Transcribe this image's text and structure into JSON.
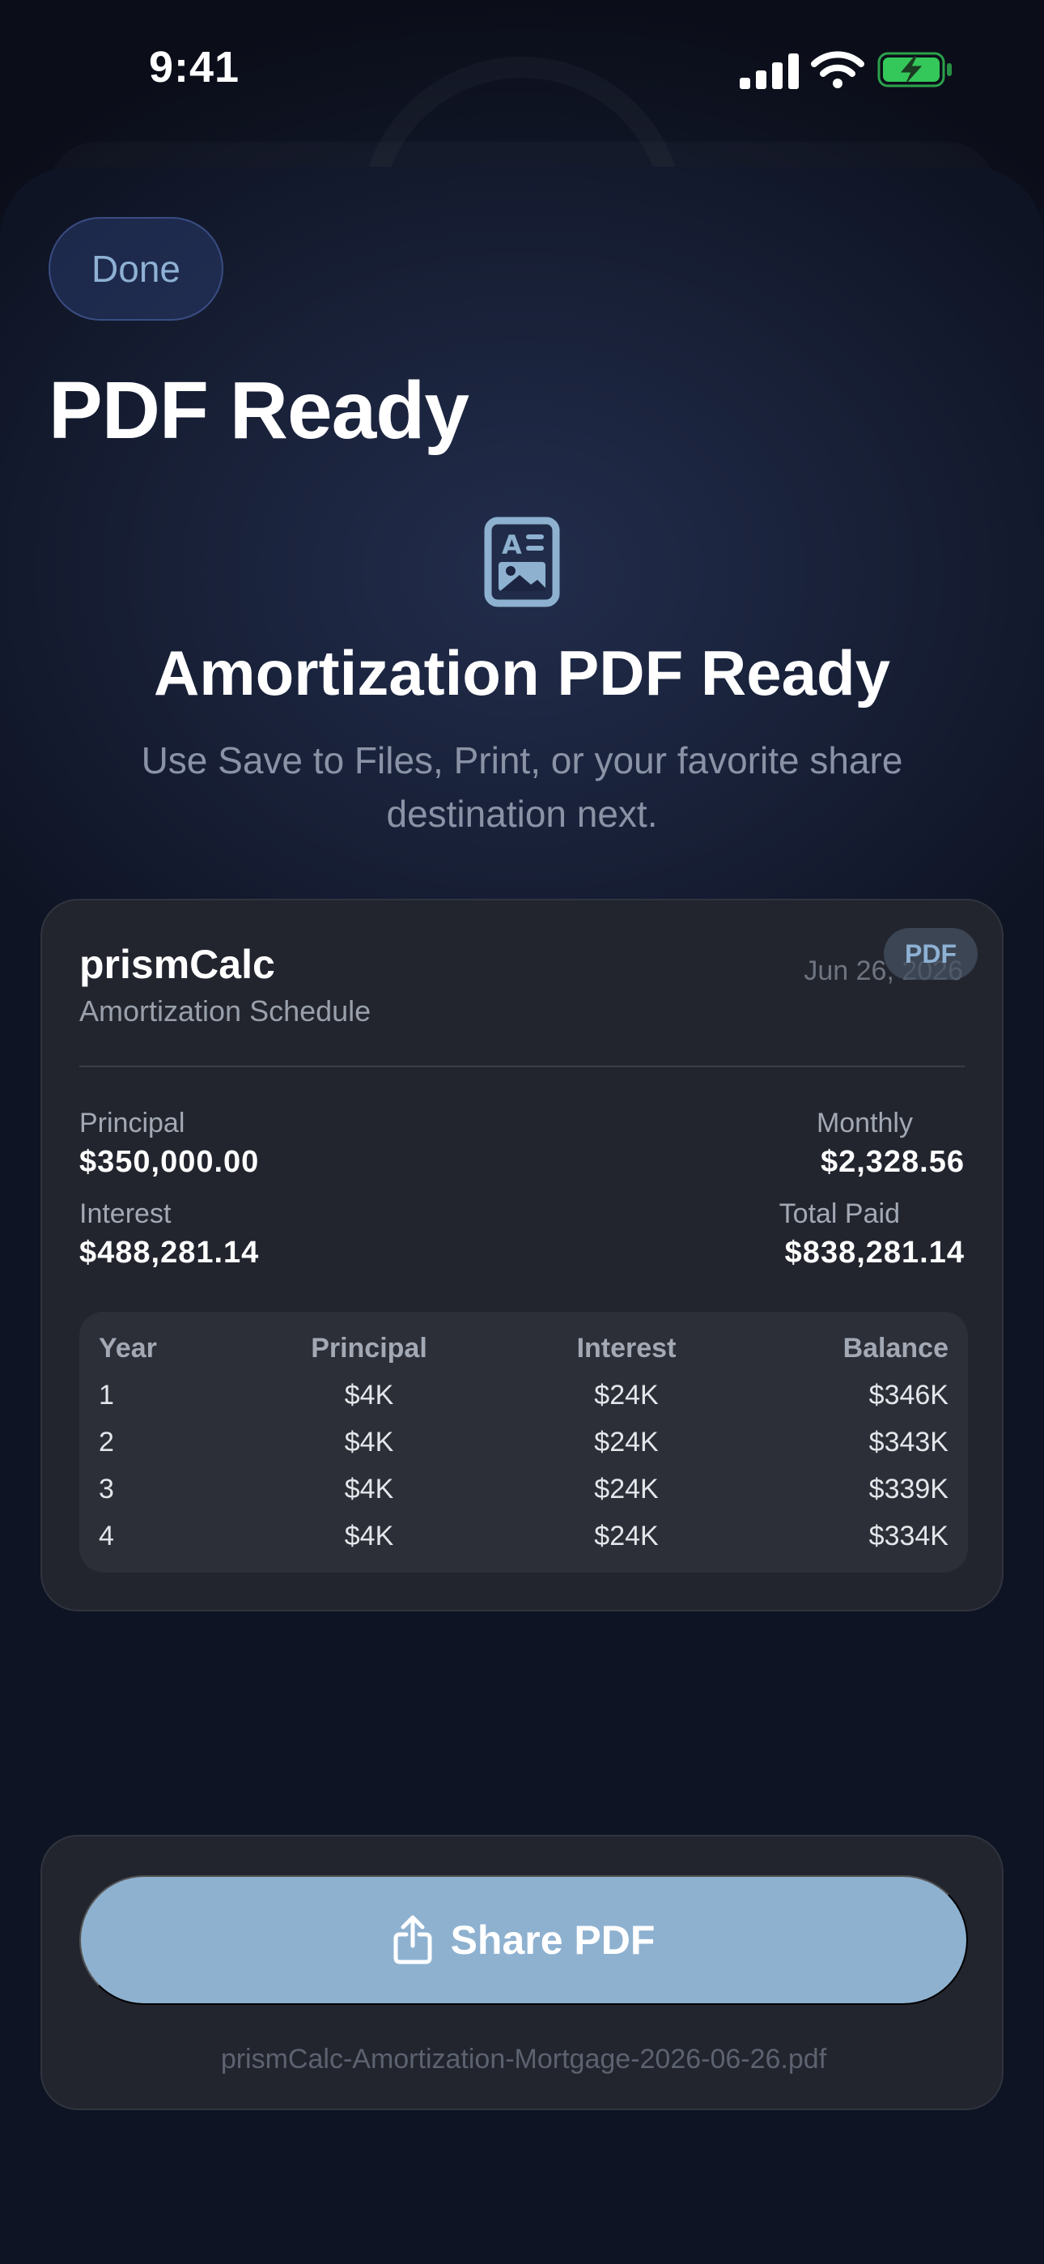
{
  "status_bar": {
    "time": "9:41"
  },
  "nav": {
    "done_label": "Done",
    "title": "PDF Ready"
  },
  "hero": {
    "icon": "document-image-icon",
    "title": "Amortization PDF Ready",
    "subtitle": "Use Save to Files, Print, or your favorite share destination next."
  },
  "preview": {
    "brand": "prismCalc",
    "doc_type": "Amortization Schedule",
    "date": "Jun 26, 2026",
    "badge": "PDF",
    "stats": {
      "principal_label": "Principal",
      "principal_value": "$350,000.00",
      "monthly_label": "Monthly",
      "monthly_value": "$2,328.56",
      "interest_label": "Interest",
      "interest_value": "$488,281.14",
      "total_label": "Total Paid",
      "total_value": "$838,281.14"
    },
    "table": {
      "headers": [
        "Year",
        "Principal",
        "Interest",
        "Balance"
      ],
      "rows": [
        [
          "1",
          "$4K",
          "$24K",
          "$346K"
        ],
        [
          "2",
          "$4K",
          "$24K",
          "$343K"
        ],
        [
          "3",
          "$4K",
          "$24K",
          "$339K"
        ],
        [
          "4",
          "$4K",
          "$24K",
          "$334K"
        ]
      ]
    }
  },
  "share": {
    "label": "Share PDF",
    "icon": "share-icon",
    "filename": "prismCalc-Amortization-Mortgage-2026-06-26.pdf"
  },
  "colors": {
    "accent": "#8EB1D0",
    "card": "#22252E",
    "battery": "#34C759"
  }
}
